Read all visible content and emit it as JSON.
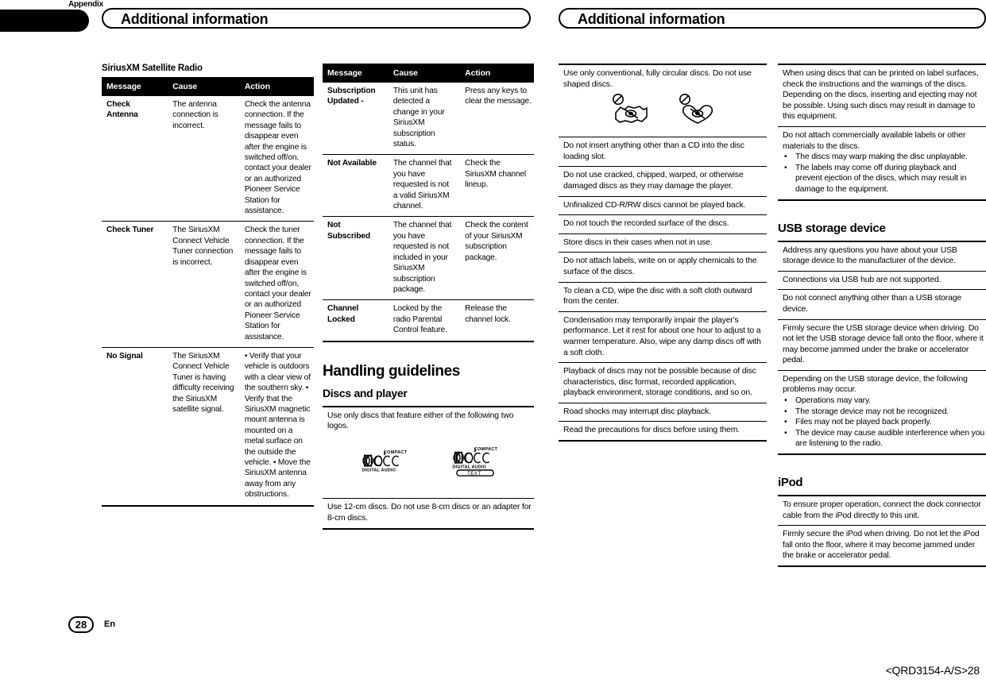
{
  "page": {
    "chapter_tab": "Appendix",
    "header_left": "Additional information",
    "header_right": "Additional information",
    "page_number": "28",
    "language_code": "En",
    "document_code": "<QRD3154-A/S>28"
  },
  "col1": {
    "section_title": "SiriusXM Satellite Radio",
    "table": {
      "headers": [
        "Message",
        "Cause",
        "Action"
      ],
      "rows": [
        {
          "message": "Check Antenna",
          "cause": "The antenna connection is incorrect.",
          "action": "Check the antenna connection. If the message fails to disappear even after the engine is switched off/on, contact your dealer or an authorized Pioneer Service Station for assistance."
        },
        {
          "message": "Check Tuner",
          "cause": "The SiriusXM Connect Vehicle Tuner connection is incorrect.",
          "action": "Check the tuner connection. If the message fails to disappear even after the engine is switched off/on, contact your dealer or an authorized Pioneer Service Station for assistance."
        },
        {
          "message": "No Signal",
          "cause": "The SiriusXM Connect Vehicle Tuner is having difficulty receiving the SiriusXM satellite signal.",
          "action": "• Verify that your vehicle is outdoors with a clear view of the southern sky. • Verify that the SiriusXM magnetic mount antenna is mounted on a metal surface on the outside the vehicle. • Move the SiriusXM antenna away from any obstructions."
        }
      ]
    }
  },
  "col2": {
    "table": {
      "headers": [
        "Message",
        "Cause",
        "Action"
      ],
      "rows": [
        {
          "message": "Subscription Updated -",
          "cause": "This unit has detected a change in your SiriusXM subscription status.",
          "action": "Press any keys to clear the message."
        },
        {
          "message": "Not Available",
          "cause": "The channel that you have requested is not a valid SiriusXM channel.",
          "action": "Check the SiriusXM channel lineup."
        },
        {
          "message": "Not Subscribed",
          "cause": "The channel that you have requested is not included in your SiriusXM subscription package.",
          "action": "Check the content of your SiriusXM subscription package."
        },
        {
          "message": "Channel Locked",
          "cause": "Locked by the radio Parental Control feature.",
          "action": "Release the channel lock."
        }
      ]
    },
    "handling_title": "Handling guidelines",
    "discs_title": "Discs and player",
    "rules": [
      "Use only discs that feature either of the following two logos.",
      "Use 12-cm discs. Do not use 8-cm discs or an adapter for 8-cm discs."
    ],
    "logos": [
      "compact-disc-digital-audio",
      "compact-disc-digital-audio-text"
    ]
  },
  "col3": {
    "rules": [
      "Use only conventional, fully circular discs. Do not use shaped discs.",
      "Do not insert anything other than a CD into the disc loading slot.",
      "Do not use cracked, chipped, warped, or otherwise damaged discs as they may damage the player.",
      "Unfinalized CD-R/RW discs cannot be played back.",
      "Do not touch the recorded surface of the discs.",
      "Store discs in their cases when not in use.",
      "Do not attach labels, write on or apply chemicals to the surface of the discs.",
      "To clean a CD, wipe the disc with a soft cloth outward from the center.",
      "Condensation may temporarily impair the player's performance. Let it rest for about one hour to adjust to a warmer temperature. Also, wipe any damp discs off with a soft cloth.",
      "Playback of discs may not be possible because of disc characteristics, disc format, recorded application, playback environment, storage conditions, and so on.",
      "Road shocks may interrupt disc playback.",
      "Read the precautions for discs before using them."
    ]
  },
  "col4": {
    "disc_rules": [
      "When using discs that can be printed on label surfaces, check the instructions and the warnings of the discs. Depending on the discs, inserting and ejecting may not be possible. Using such discs may result in damage to this equipment.",
      "Do not attach commercially available labels or other materials to the discs."
    ],
    "label_bullets": [
      "The discs may warp making the disc unplayable.",
      "The labels may come off during playback and prevent ejection of the discs, which may result in damage to the equipment."
    ],
    "usb_title": "USB storage device",
    "usb_rules": [
      "Address any questions you have about your USB storage device to the manufacturer of the device.",
      "Connections via USB hub are not supported.",
      "Do not connect anything other than a USB storage device.",
      "Firmly secure the USB storage device when driving. Do not let the USB storage device fall onto the floor, where it may become jammed under the brake or accelerator pedal.",
      "Depending on the USB storage device, the following problems may occur."
    ],
    "usb_bullets": [
      "Operations may vary.",
      "The storage device may not be recognized.",
      "Files may not be played back properly.",
      "The device may cause audible interference when you are listening to the radio."
    ],
    "ipod_title": "iPod",
    "ipod_rules": [
      "To ensure proper operation, connect the dock connector cable from the iPod directly to this unit.",
      "Firmly secure the iPod when driving. Do not let the iPod fall onto the floor, where it may become jammed under the brake or accelerator pedal."
    ]
  }
}
